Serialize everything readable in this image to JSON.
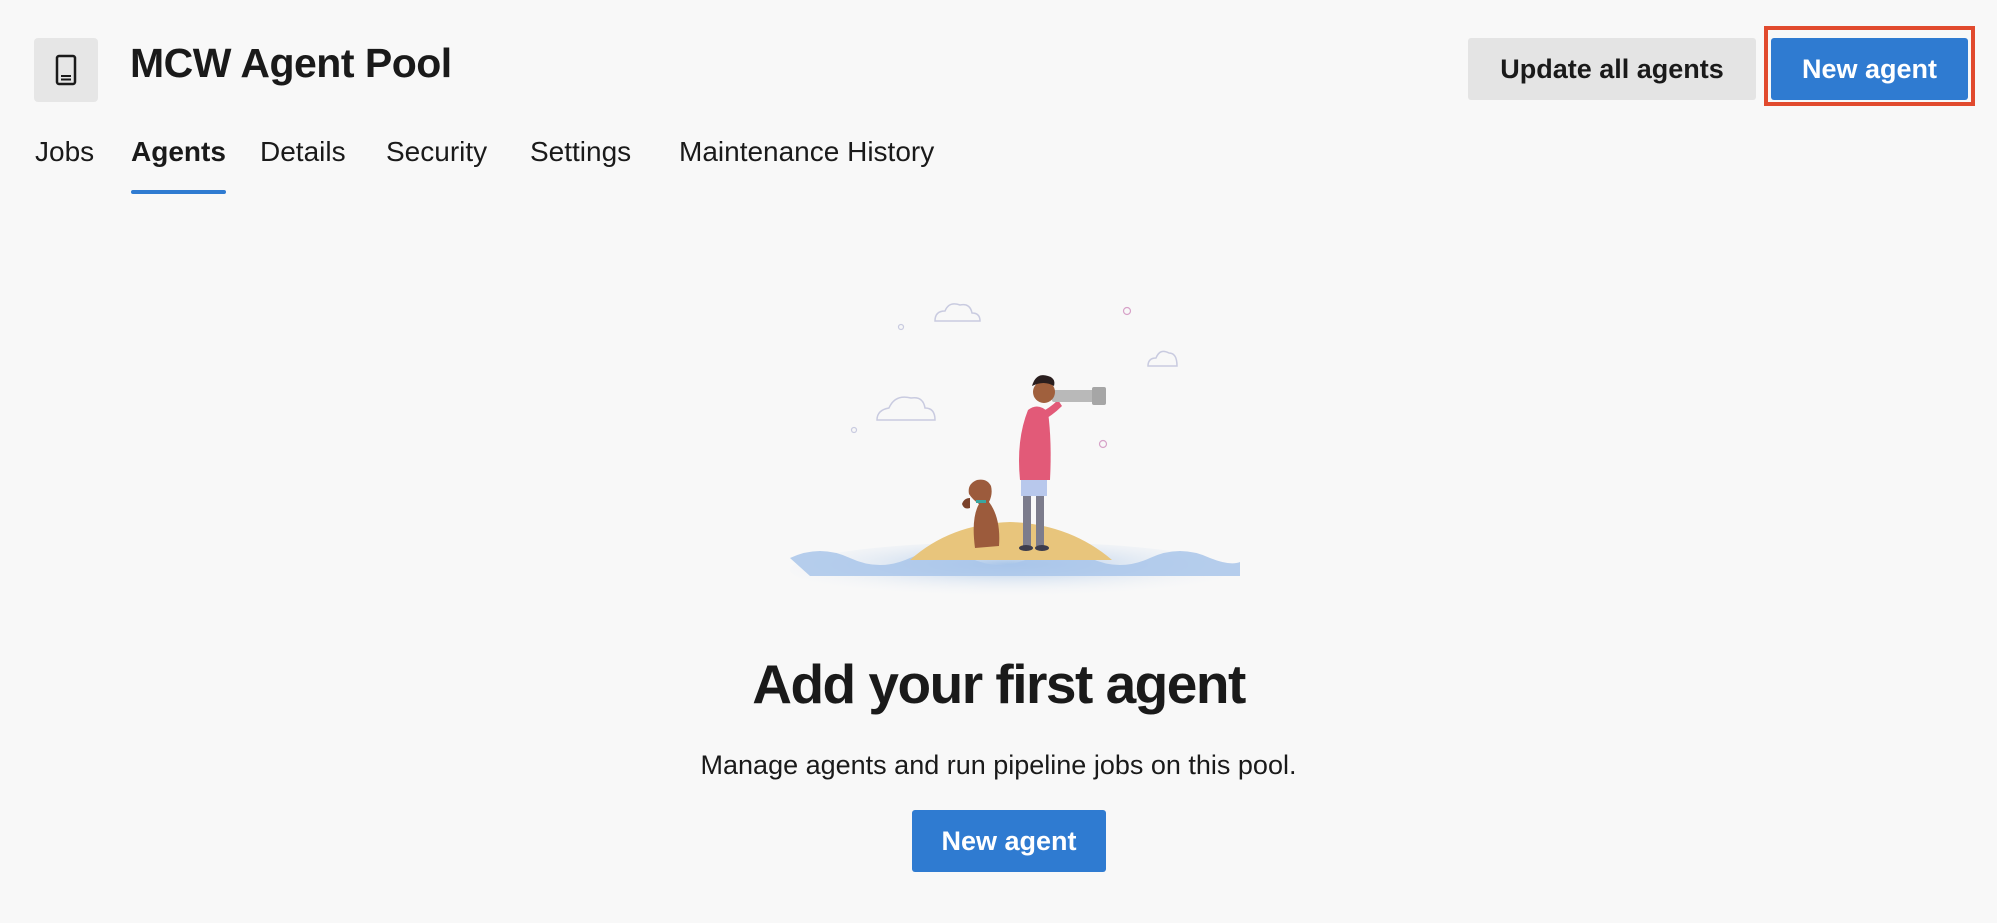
{
  "header": {
    "pool_icon": "server-device-icon",
    "title": "MCW Agent Pool",
    "update_all_label": "Update all agents",
    "new_agent_label": "New agent"
  },
  "tabs": [
    {
      "label": "Jobs",
      "active": false
    },
    {
      "label": "Agents",
      "active": true
    },
    {
      "label": "Details",
      "active": false
    },
    {
      "label": "Security",
      "active": false
    },
    {
      "label": "Settings",
      "active": false
    },
    {
      "label": "Maintenance History",
      "active": false
    }
  ],
  "empty_state": {
    "illustration": "person-with-telescope-and-dog-on-island-illustration",
    "title": "Add your first agent",
    "description": "Manage agents and run pipeline jobs on this pool.",
    "button_label": "New agent"
  },
  "colors": {
    "accent": "#2f7bd1",
    "highlight": "#e14a2e",
    "background": "#f8f8f8",
    "secondary_button": "#e4e4e4"
  }
}
